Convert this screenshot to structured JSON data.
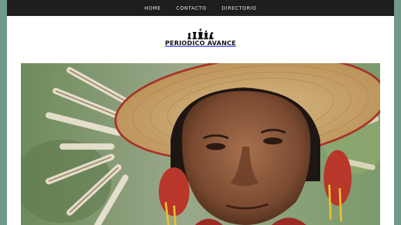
{
  "nav": {
    "items": [
      {
        "label": "HOME"
      },
      {
        "label": "CONTACTO"
      },
      {
        "label": "DIRECTORIO"
      }
    ]
  },
  "site": {
    "logo_text": "PERIODICO AVANCE",
    "logo_icon": "chess-pieces-icon"
  },
  "hero": {
    "image_subject": "portrait-photo"
  },
  "colors": {
    "background": "#6f9a88",
    "nav_bar": "#1e1e1e",
    "page": "#ffffff"
  }
}
